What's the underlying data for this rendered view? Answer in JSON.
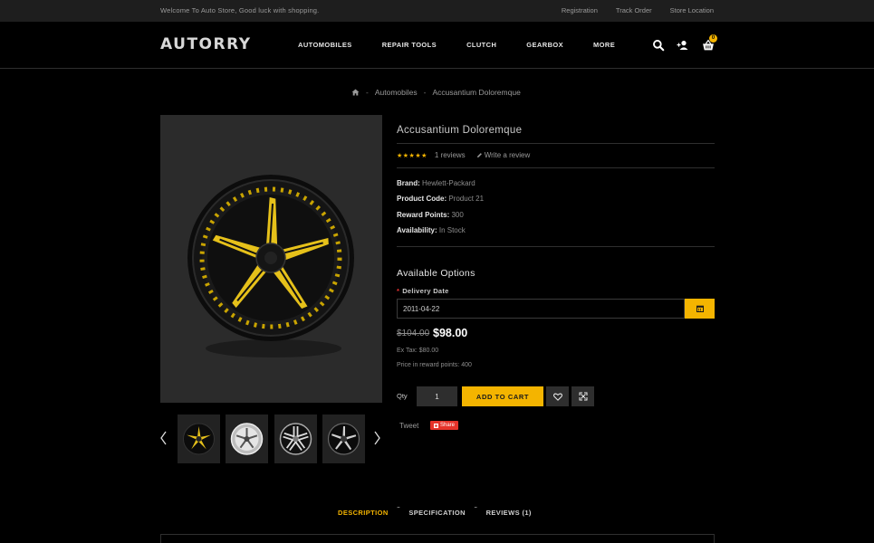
{
  "topbar": {
    "welcome": "Welcome To Auto Store, Good luck with shopping.",
    "links": [
      "Registration",
      "Track Order",
      "Store Location"
    ]
  },
  "header": {
    "logo": "AUTORRY",
    "nav": [
      "AUTOMOBILES",
      "REPAIR TOOLS",
      "CLUTCH",
      "GEARBOX",
      "MORE"
    ],
    "cart_count": "0"
  },
  "breadcrumb": {
    "items": [
      "Automobiles",
      "Accusantium Doloremque"
    ],
    "separator": "-"
  },
  "product": {
    "title": "Accusantium Doloremque",
    "reviews": "1 reviews",
    "write_review": "Write a review",
    "brand_label": "Brand:",
    "brand_value": "Hewlett-Packard",
    "code_label": "Product Code:",
    "code_value": "Product 21",
    "points_label": "Reward Points:",
    "points_value": "300",
    "availability_label": "Availability:",
    "availability_value": "In Stock",
    "rating": 5
  },
  "options": {
    "title": "Available Options",
    "delivery_label": "Delivery Date",
    "required_mark": "*",
    "delivery_value": "2011-04-22"
  },
  "pricing": {
    "old_price": "$104.00",
    "new_price": "$98.00",
    "ex_tax": "Ex Tax: $80.00",
    "reward_points": "Price in reward points: 400"
  },
  "purchase": {
    "qty_label": "Qty",
    "qty_value": "1",
    "add_to_cart": "ADD TO CART"
  },
  "social": {
    "tweet": "Tweet",
    "share": "Share"
  },
  "tabs": [
    "DESCRIPTION",
    "SPECIFICATION",
    "REVIEWS (1)"
  ],
  "colors": {
    "accent": "#f4b400",
    "background": "#000000",
    "panel": "#2b2b2b"
  }
}
